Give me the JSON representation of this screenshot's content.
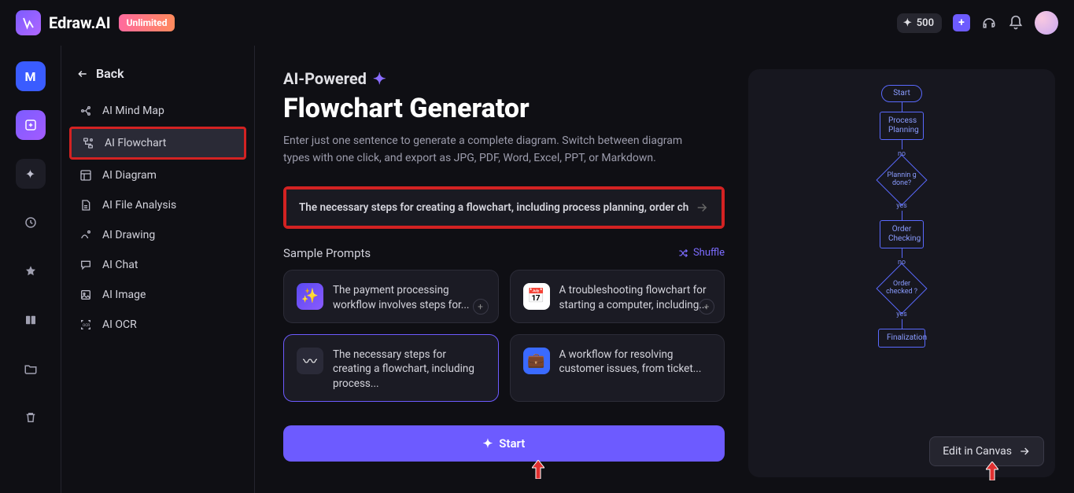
{
  "brand": {
    "name": "Edraw.AI",
    "badge": "Unlimited"
  },
  "topbar": {
    "credits": "500"
  },
  "sidebar": {
    "back": "Back",
    "items": [
      {
        "label": "AI Mind Map"
      },
      {
        "label": "AI Flowchart"
      },
      {
        "label": "AI Diagram"
      },
      {
        "label": "AI File Analysis"
      },
      {
        "label": "AI Drawing"
      },
      {
        "label": "AI Chat"
      },
      {
        "label": "AI Image"
      },
      {
        "label": "AI OCR"
      }
    ]
  },
  "main": {
    "kicker": "AI-Powered",
    "title": "Flowchart Generator",
    "description": "Enter just one sentence to generate a complete diagram. Switch between diagram types with one click, and export as JPG, PDF, Word, Excel, PPT, or Markdown.",
    "input": "The necessary steps for creating a flowchart, including process planning, order checki",
    "sample_title": "Sample Prompts",
    "shuffle": "Shuffle",
    "cards": [
      {
        "text": "The payment processing workflow involves steps for..."
      },
      {
        "text": "A troubleshooting flowchart for starting a computer, including..."
      },
      {
        "text": "The necessary steps for creating a flowchart, including process..."
      },
      {
        "text": "A workflow for resolving customer issues, from ticket..."
      }
    ],
    "start": "Start"
  },
  "preview": {
    "edit": "Edit in Canvas",
    "nodes": {
      "start": "Start",
      "planning": "Process Planning",
      "q1": "Plannin g done?",
      "checking": "Order Checking",
      "q2": "Order checked ?",
      "final": "Finalization"
    },
    "labels": {
      "yes": "yes",
      "no": "no"
    }
  },
  "rail": {
    "letter": "M"
  }
}
